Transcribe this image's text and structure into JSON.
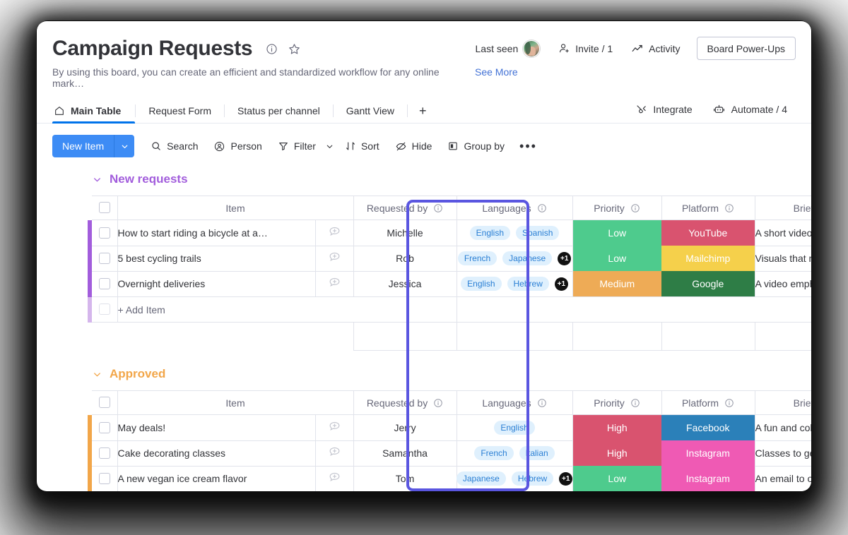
{
  "board": {
    "title": "Campaign Requests",
    "description": "By using this board, you can create an efficient and standardized workflow for any online mark…",
    "see_more": "See More",
    "info_icon": "info-icon",
    "favorite_icon": "star-icon"
  },
  "header_actions": {
    "last_seen": "Last seen",
    "invite": "Invite / 1",
    "activity": "Activity",
    "power_ups": "Board Power-Ups"
  },
  "tabs": {
    "items": [
      {
        "label": "Main Table",
        "active": true,
        "icon": "home-icon"
      },
      {
        "label": "Request Form",
        "active": false
      },
      {
        "label": "Status per channel",
        "active": false
      },
      {
        "label": "Gantt View",
        "active": false
      }
    ],
    "add_label": "+",
    "right": [
      {
        "label": "Integrate",
        "icon": "integrate-icon"
      },
      {
        "label": "Automate / 4",
        "icon": "robot-icon"
      }
    ]
  },
  "toolbar": {
    "new_item": "New Item",
    "new_item_caret": "chevron-down-icon",
    "items": [
      {
        "label": "Search",
        "icon": "search-icon"
      },
      {
        "label": "Person",
        "icon": "person-icon"
      },
      {
        "label": "Filter",
        "icon": "filter-icon",
        "caret": true
      },
      {
        "label": "Sort",
        "icon": "sort-icon"
      },
      {
        "label": "Hide",
        "icon": "eye-off-icon"
      },
      {
        "label": "Group by",
        "icon": "group-by-icon"
      }
    ],
    "more": "•••"
  },
  "columns": [
    {
      "key": "item",
      "label": "Item",
      "info": false
    },
    {
      "key": "requested_by",
      "label": "Requested by",
      "info": true
    },
    {
      "key": "languages",
      "label": "Languages",
      "info": true
    },
    {
      "key": "priority",
      "label": "Priority",
      "info": true
    },
    {
      "key": "platform",
      "label": "Platform",
      "info": true
    },
    {
      "key": "brief",
      "label": "Brief",
      "info": true
    }
  ],
  "groups": [
    {
      "name": "New requests",
      "color": "#a25ddc",
      "add_item_label": "+ Add Item",
      "rows": [
        {
          "item": "How to start riding a bicycle at a…",
          "requested_by": "Michelle",
          "languages": [
            "English",
            "Spanish"
          ],
          "extra_count": "",
          "priority": {
            "label": "Low",
            "color": "#4ecb8d"
          },
          "platform": {
            "label": "YouTube",
            "color": "#d9536f"
          },
          "brief": "A short video with a…"
        },
        {
          "item": "5 best cycling trails",
          "requested_by": "Rob",
          "languages": [
            "French",
            "Japanese"
          ],
          "extra_count": "+1",
          "priority": {
            "label": "Low",
            "color": "#4ecb8d"
          },
          "platform": {
            "label": "Mailchimp",
            "color": "#f5d04b"
          },
          "brief": "Visuals that makes …"
        },
        {
          "item": "Overnight deliveries",
          "requested_by": "Jessica",
          "languages": [
            "English",
            "Hebrew"
          ],
          "extra_count": "+1",
          "priority": {
            "label": "Medium",
            "color": "#eeab56"
          },
          "platform": {
            "label": "Google",
            "color": "#2e7d46"
          },
          "brief": "A video emphasisin…"
        }
      ]
    },
    {
      "name": "Approved",
      "color": "#f2a649",
      "add_item_label": "",
      "rows": [
        {
          "item": "May deals!",
          "requested_by": "Jerry",
          "languages": [
            "English"
          ],
          "extra_count": "",
          "priority": {
            "label": "High",
            "color": "#d9536f"
          },
          "platform": {
            "label": "Facebook",
            "color": "#2b80b9"
          },
          "brief": "A fun and colorful p…"
        },
        {
          "item": "Cake decorating classes",
          "requested_by": "Samantha",
          "languages": [
            "French",
            "Italian"
          ],
          "extra_count": "",
          "priority": {
            "label": "High",
            "color": "#d9536f"
          },
          "platform": {
            "label": "Instagram",
            "color": "#ef5ab4"
          },
          "brief": "Classes to get our …"
        },
        {
          "item": "A new vegan ice cream flavor",
          "requested_by": "Tom",
          "languages": [
            "Japanese",
            "Hebrew"
          ],
          "extra_count": "+1",
          "priority": {
            "label": "Low",
            "color": "#4ecb8d"
          },
          "platform": {
            "label": "Instagram",
            "color": "#ef5ab4"
          },
          "brief": "An email to our exit…"
        }
      ]
    }
  ],
  "highlight": {
    "color": "#5a56e0",
    "target_column": "languages"
  }
}
